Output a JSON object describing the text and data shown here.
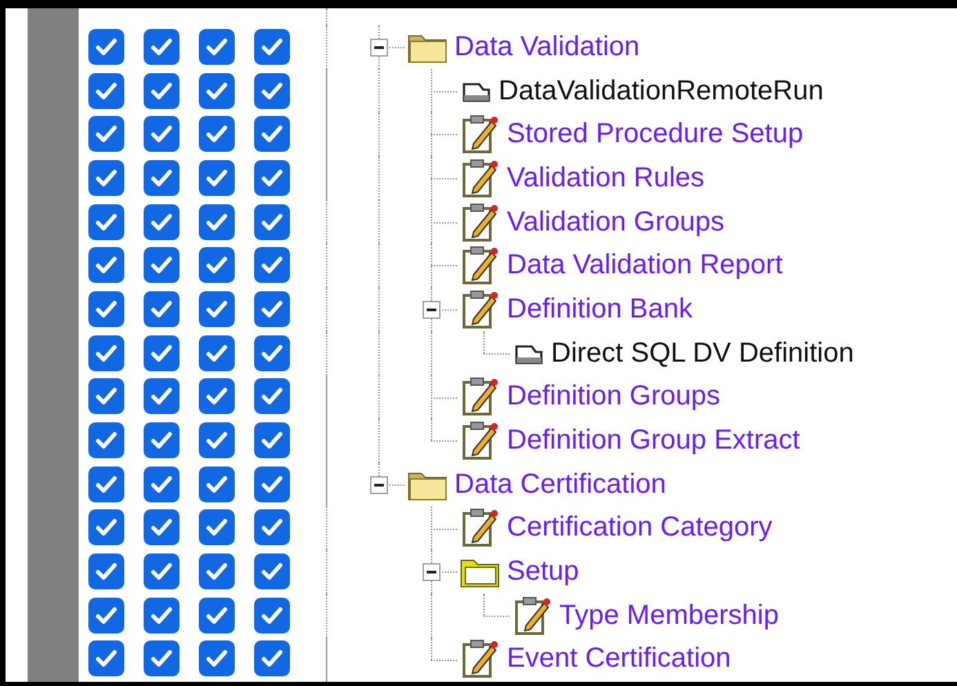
{
  "tree": [
    {
      "label": "Data Validation",
      "kind": "folder",
      "expanded": true,
      "checks": [
        true,
        true,
        true,
        true
      ],
      "children": [
        {
          "label": "DataValidationRemoteRun",
          "kind": "document",
          "checks": [
            true,
            true,
            true,
            true
          ]
        },
        {
          "label": "Stored Procedure Setup",
          "kind": "report",
          "checks": [
            true,
            true,
            true,
            true
          ]
        },
        {
          "label": "Validation Rules",
          "kind": "report",
          "checks": [
            true,
            true,
            true,
            true
          ]
        },
        {
          "label": "Validation Groups",
          "kind": "report",
          "checks": [
            true,
            true,
            true,
            true
          ]
        },
        {
          "label": "Data Validation Report",
          "kind": "report",
          "checks": [
            true,
            true,
            true,
            true
          ]
        },
        {
          "label": "Definition Bank",
          "kind": "report",
          "expanded": true,
          "checks": [
            true,
            true,
            true,
            true
          ],
          "children": [
            {
              "label": "Direct SQL DV Definition",
              "kind": "document",
              "checks": [
                true,
                true,
                true,
                true
              ]
            }
          ]
        },
        {
          "label": "Definition Groups",
          "kind": "report",
          "checks": [
            true,
            true,
            true,
            true
          ]
        },
        {
          "label": "Definition Group Extract",
          "kind": "report",
          "checks": [
            true,
            true,
            true,
            true
          ]
        }
      ]
    },
    {
      "label": "Data Certification",
      "kind": "folder",
      "expanded": true,
      "checks": [
        true,
        true,
        true,
        true
      ],
      "children": [
        {
          "label": "Certification Category",
          "kind": "report",
          "checks": [
            true,
            true,
            true,
            true
          ]
        },
        {
          "label": "Setup",
          "kind": "open-folder",
          "expanded": true,
          "checks": [
            true,
            true,
            true,
            true
          ],
          "children": [
            {
              "label": "Type Membership",
              "kind": "report",
              "checks": [
                true,
                true,
                true,
                true
              ]
            }
          ]
        },
        {
          "label": "Event Certification",
          "kind": "report",
          "checks": [
            true,
            true,
            true,
            true
          ]
        }
      ]
    }
  ]
}
